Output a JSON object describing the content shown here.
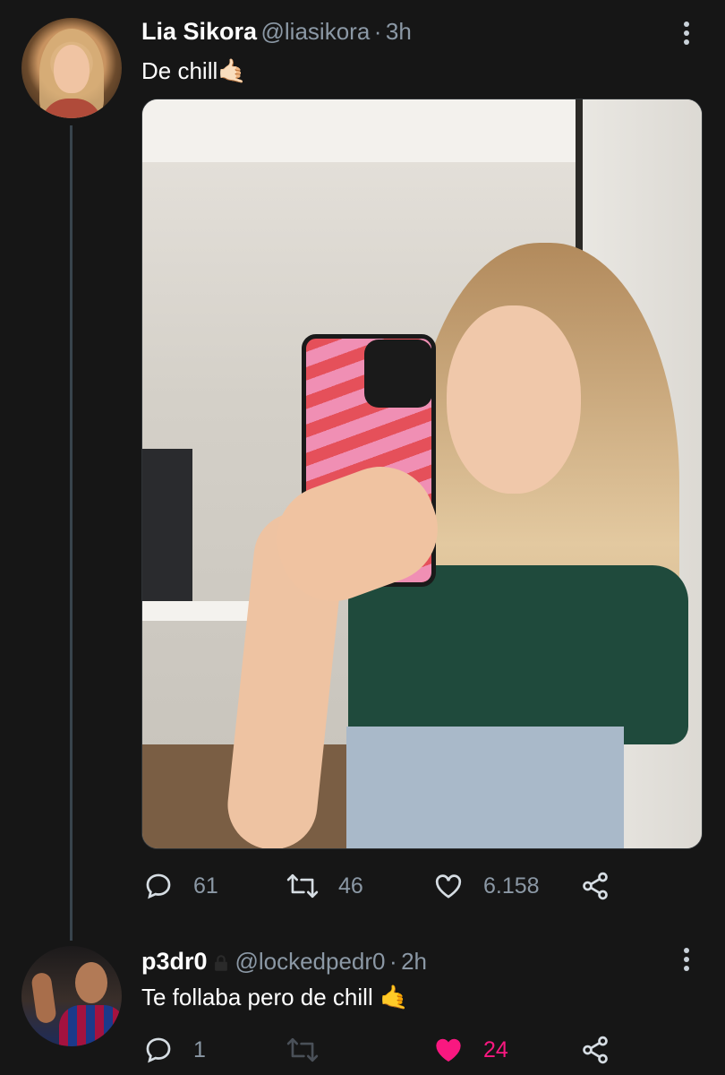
{
  "thread": {
    "tweet": {
      "author_name": "Lia Sikora",
      "author_handle": "@liasikora",
      "separator": "·",
      "time": "3h",
      "text": "De chill🤙🏻",
      "stats": {
        "replies": "61",
        "retweets": "46",
        "likes": "6.158"
      }
    },
    "reply": {
      "author_name": "p3dr0",
      "author_handle": "@lockedpedr0",
      "separator": "·",
      "time": "2h",
      "text": "Te follaba pero de chill 🤙",
      "stats": {
        "replies": "1",
        "retweets": "",
        "likes": "24"
      },
      "liked": true
    }
  },
  "icons": {
    "reply": "reply-icon",
    "retweet": "retweet-icon",
    "like": "heart-icon",
    "share": "share-icon",
    "more": "more-icon",
    "lock": "lock-icon"
  },
  "colors": {
    "background": "#161616",
    "text_primary": "#ffffff",
    "text_secondary": "#8b98a5",
    "like_active": "#f91880"
  }
}
